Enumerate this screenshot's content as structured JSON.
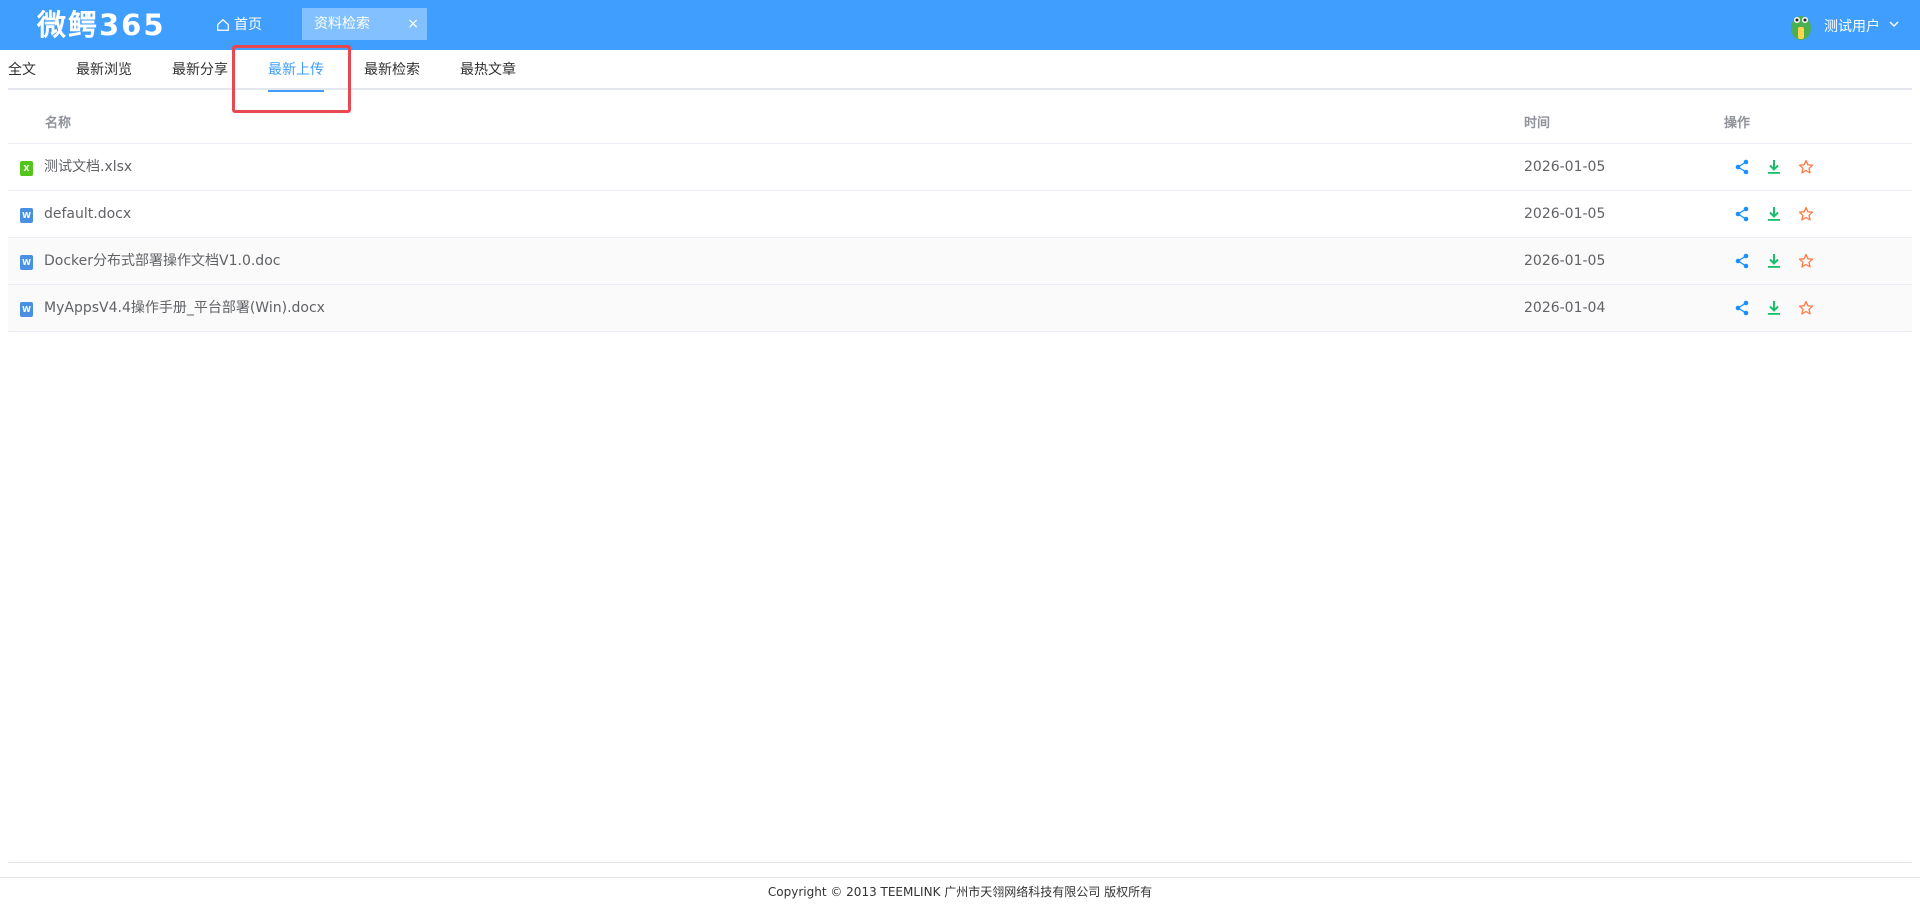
{
  "header": {
    "logo": "微鳄365",
    "home_label": "首页",
    "open_tab_label": "资料检索",
    "open_tab_close": "×",
    "user_name": "测试用户"
  },
  "tabs": [
    {
      "label": "全文",
      "active": false
    },
    {
      "label": "最新浏览",
      "active": false
    },
    {
      "label": "最新分享",
      "active": false
    },
    {
      "label": "最新上传",
      "active": true
    },
    {
      "label": "最新检索",
      "active": false
    },
    {
      "label": "最热文章",
      "active": false
    }
  ],
  "table": {
    "columns": {
      "name": "名称",
      "time": "时间",
      "actions": "操作"
    },
    "rows": [
      {
        "type": "xlsx",
        "icon_letter": "X",
        "name": "测试文档.xlsx",
        "time": "2026-01-05"
      },
      {
        "type": "docx",
        "icon_letter": "W",
        "name": "default.docx",
        "time": "2026-01-05"
      },
      {
        "type": "docx",
        "icon_letter": "W",
        "name": "Docker分布式部署操作文档V1.0.doc",
        "time": "2026-01-05"
      },
      {
        "type": "docx",
        "icon_letter": "W",
        "name": "MyAppsV4.4操作手册_平台部署(Win).docx",
        "time": "2026-01-04"
      }
    ]
  },
  "colors": {
    "accent": "#409eff",
    "share": "#1890ff",
    "download": "#19be6b",
    "favorite": "#ff7a45",
    "highlight": "#e8484f"
  },
  "footer": {
    "copyright": "Copyright © 2013 TEEMLINK 广州市天翎网络科技有限公司 版权所有"
  }
}
